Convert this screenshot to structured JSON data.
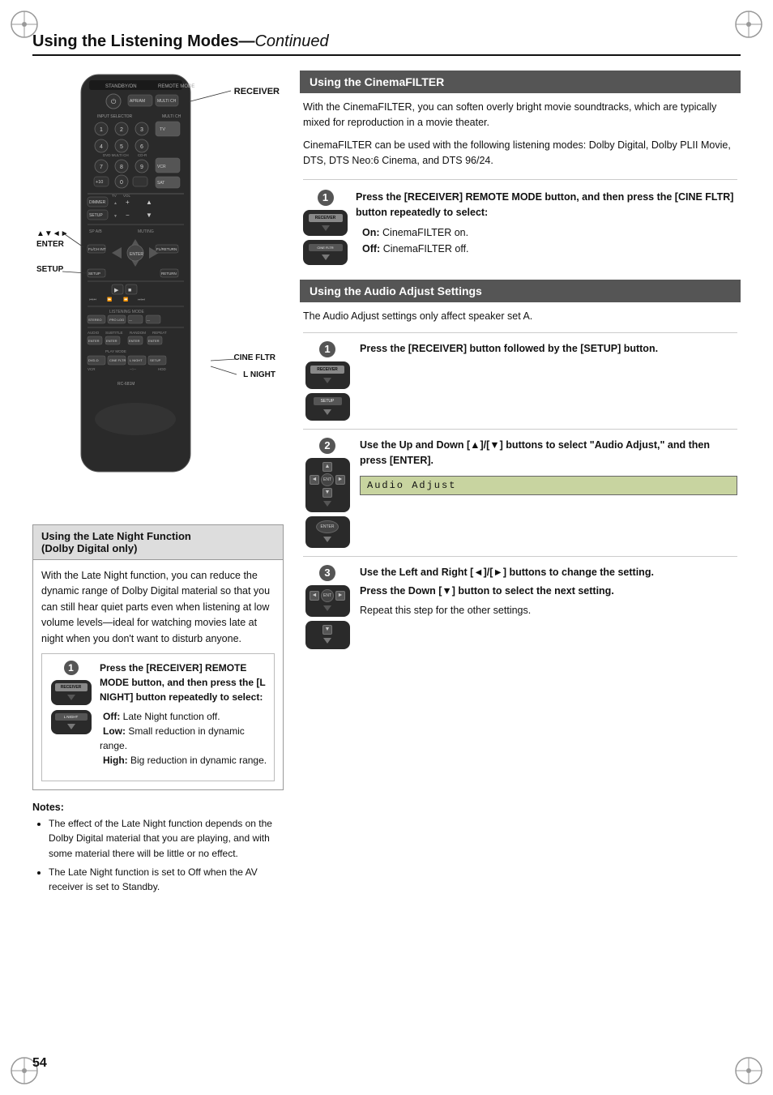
{
  "page": {
    "number": "54",
    "title": "Using the Listening Modes",
    "title_suffix": "Continued"
  },
  "remote_labels": {
    "receiver": "RECEIVER",
    "enter": "▲▼◄►\nENTER",
    "setup": "SETUP",
    "cine_fltr": "CINE FLTR",
    "l_night": "L NIGHT"
  },
  "cinema_filter": {
    "title": "Using the CinemaFILTER",
    "intro": "With the CinemaFILTER, you can soften overly bright movie soundtracks, which are typically mixed for reproduction in a movie theater.",
    "modes_text": "CinemaFILTER can be used with the following listening modes: Dolby Digital, Dolby PLII Movie, DTS, DTS Neo:6 Cinema, and DTS 96/24.",
    "step1": {
      "number": "1",
      "instruction": "Press the [RECEIVER] REMOTE MODE button, and then press the [CINE FLTR] button repeatedly to select:",
      "on_label": "On:",
      "on_value": "CinemaFILTER on.",
      "off_label": "Off:",
      "off_value": "CinemaFILTER off."
    }
  },
  "audio_adjust": {
    "title": "Using the Audio Adjust Settings",
    "intro": "The Audio Adjust settings only affect speaker set A.",
    "step1": {
      "number": "1",
      "instruction": "Press the [RECEIVER] button followed by the [SETUP] button."
    },
    "step2": {
      "number": "2",
      "instruction": "Use the Up and Down [▲]/[▼] buttons to select \"Audio Adjust,\" and then press [ENTER].",
      "lcd_text": "Audio Adjust"
    },
    "step3": {
      "number": "3",
      "instruction": "Use the Left and Right [◄]/[►] buttons to change the setting.",
      "instruction2": "Press the Down [▼] button to select the next setting.",
      "instruction3": "Repeat this step for the other settings."
    }
  },
  "late_night": {
    "title": "Using the Late Night Function\n(Dolby Digital only)",
    "intro": "With the Late Night function, you can reduce the dynamic range of Dolby Digital material so that you can still hear quiet parts even when listening at low volume levels—ideal for watching movies late at night when you don't want to disturb anyone.",
    "step1": {
      "number": "1",
      "instruction": "Press the [RECEIVER] REMOTE MODE button, and then press the [L NIGHT] button repeatedly to select:",
      "off_label": "Off:",
      "off_value": "Late Night function off.",
      "low_label": "Low:",
      "low_value": "Small reduction in dynamic range.",
      "high_label": "High:",
      "high_value": "Big reduction in dynamic range."
    },
    "notes_title": "Notes:",
    "notes": [
      "The effect of the Late Night function depends on the Dolby Digital material that you are playing, and with some material there will be little or no effect.",
      "The Late Night function is set to Off when the AV receiver is set to Standby."
    ]
  }
}
